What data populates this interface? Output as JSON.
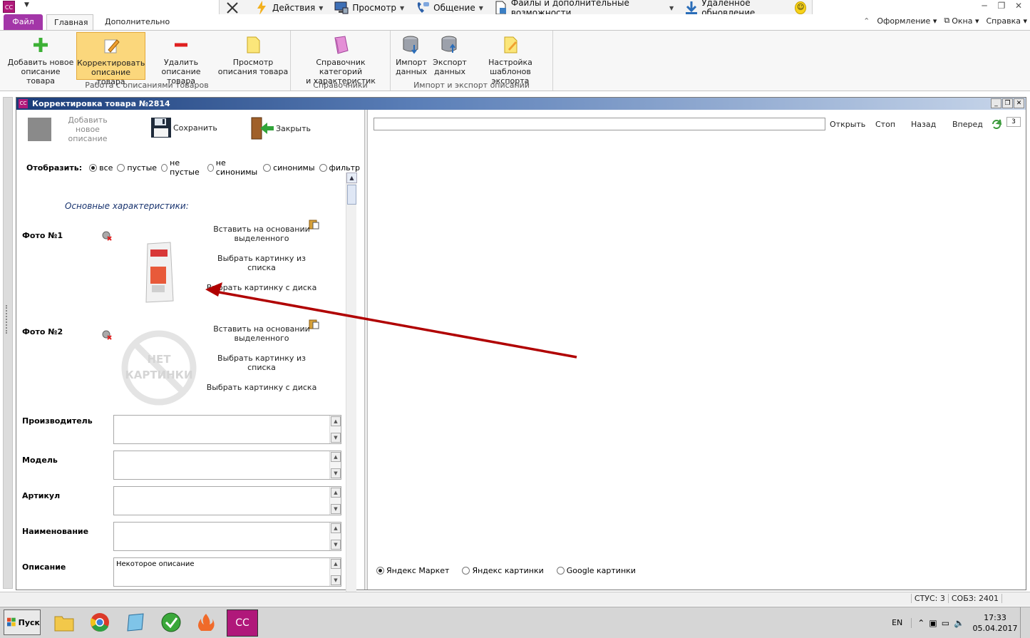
{
  "topbar": {
    "commands": [
      {
        "icon": "close-x-icon",
        "label": ""
      },
      {
        "icon": "lightning-icon",
        "label": "Действия"
      },
      {
        "icon": "monitor-icon",
        "label": "Просмотр"
      },
      {
        "icon": "phone-icon",
        "label": "Общение"
      },
      {
        "icon": "file-icon",
        "label": "Файлы и дополнительные возможности"
      },
      {
        "icon": "download-arrow-icon",
        "label": "Удалённое обновление"
      }
    ],
    "app_badge": "CC"
  },
  "tabs": {
    "file": "Файл",
    "main": "Главная",
    "extra": "Дополнительно"
  },
  "right_menu": {
    "appearance": "Оформление",
    "windows": "Окна",
    "help": "Справка"
  },
  "ribbon": {
    "groups": [
      {
        "label": "Работа с описаниями товаров"
      },
      {
        "label": "Справочники"
      },
      {
        "label": "Импорт и экспорт описаний"
      }
    ],
    "buttons": {
      "add_desc": "Добавить новое\nописание товара",
      "edit_desc": "Корректировать\nописание товара",
      "delete_desc": "Удалить\nописание товара",
      "view_desc": "Просмотр\nописания товара",
      "categories": "Справочник категорий\nи характеристик",
      "import": "Импорт\nданных",
      "export": "Экспорт\nданных",
      "export_templates": "Настройка\nшаблонов экспорта"
    }
  },
  "document": {
    "title": "Корректировка товара №2814",
    "icon_badge": "CC"
  },
  "editor": {
    "add_new": "Добавить новое\nописание",
    "save": "Сохранить",
    "close": "Закрыть",
    "display_label": "Отобразить:",
    "display_options": [
      "все",
      "пустые",
      "не пустые",
      "не синонимы",
      "синонимы",
      "фильтр"
    ],
    "display_selected": "все",
    "section_title": "Основные характеристики:",
    "photos": [
      {
        "label": "Фото №1",
        "has_image": true
      },
      {
        "label": "Фото №2",
        "has_image": false
      }
    ],
    "photo_actions": {
      "paste": "Вставить на основании\nвыделенного",
      "from_list": "Выбрать картинку из\nсписка",
      "from_disk": "Выбрать картинку с\nдиска"
    },
    "no_image_text": "НЕТ\nКАРТИНКИ",
    "fields": [
      {
        "label": "Производитель",
        "value": ""
      },
      {
        "label": "Модель",
        "value": ""
      },
      {
        "label": "Артикул",
        "value": ""
      },
      {
        "label": "Наименование",
        "value": ""
      },
      {
        "label": "Описание",
        "value": "Некоторое описание"
      }
    ]
  },
  "browser": {
    "url_value": "",
    "open": "Открыть",
    "stop": "Стоп",
    "back": "Назад",
    "forward": "Вперед",
    "page_count": "3",
    "sources": [
      "Яндекс Маркет",
      "Яндекс картинки",
      "Google картинки"
    ],
    "source_selected": "Яндекс Маркет"
  },
  "statusbar": {
    "stus": "СТУС: 3",
    "sobz": "СОБЗ: 2401"
  },
  "taskbar": {
    "start": "Пуск",
    "lang": "EN",
    "time": "17:33",
    "date": "05.04.2017"
  },
  "colors": {
    "file_tab": "#a336a8",
    "active_button": "#fbd77c",
    "title_gradient_start": "#1a3c78",
    "annotation_arrow": "#b00000"
  }
}
